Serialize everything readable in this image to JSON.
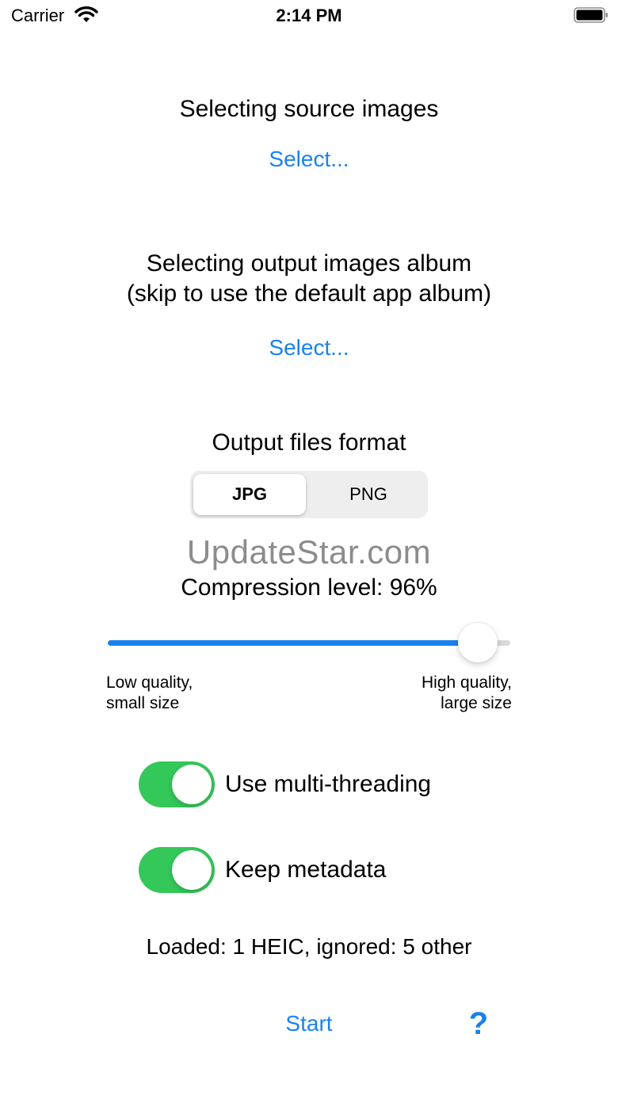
{
  "status_bar": {
    "carrier": "Carrier",
    "time": "2:14 PM",
    "icons": [
      "wifi-icon",
      "battery-icon"
    ]
  },
  "source": {
    "heading": "Selecting source images",
    "select_label": "Select..."
  },
  "output_album": {
    "heading_line1": "Selecting output images album",
    "heading_line2": "(skip to use the default app album)",
    "select_label": "Select..."
  },
  "format": {
    "heading": "Output files format",
    "options": [
      "JPG",
      "PNG"
    ],
    "selected": "JPG"
  },
  "watermark": "UpdateStar.com",
  "compression": {
    "label": "Compression level: 96%",
    "value_percent": 96,
    "slider_fill_fraction": 0.92,
    "low_line1": "Low quality,",
    "low_line2": "small size",
    "high_line1": "High quality,",
    "high_line2": "large size"
  },
  "options": {
    "multithreading_label": "Use multi-threading",
    "multithreading_on": true,
    "metadata_label": "Keep metadata",
    "metadata_on": true
  },
  "status_text": "Loaded: 1 HEIC, ignored: 5 other",
  "actions": {
    "start_label": "Start",
    "help_symbol": "?"
  },
  "colors": {
    "accent": "#1a82f0",
    "switch_on": "#34c759",
    "watermark": "#8c8c8c"
  }
}
